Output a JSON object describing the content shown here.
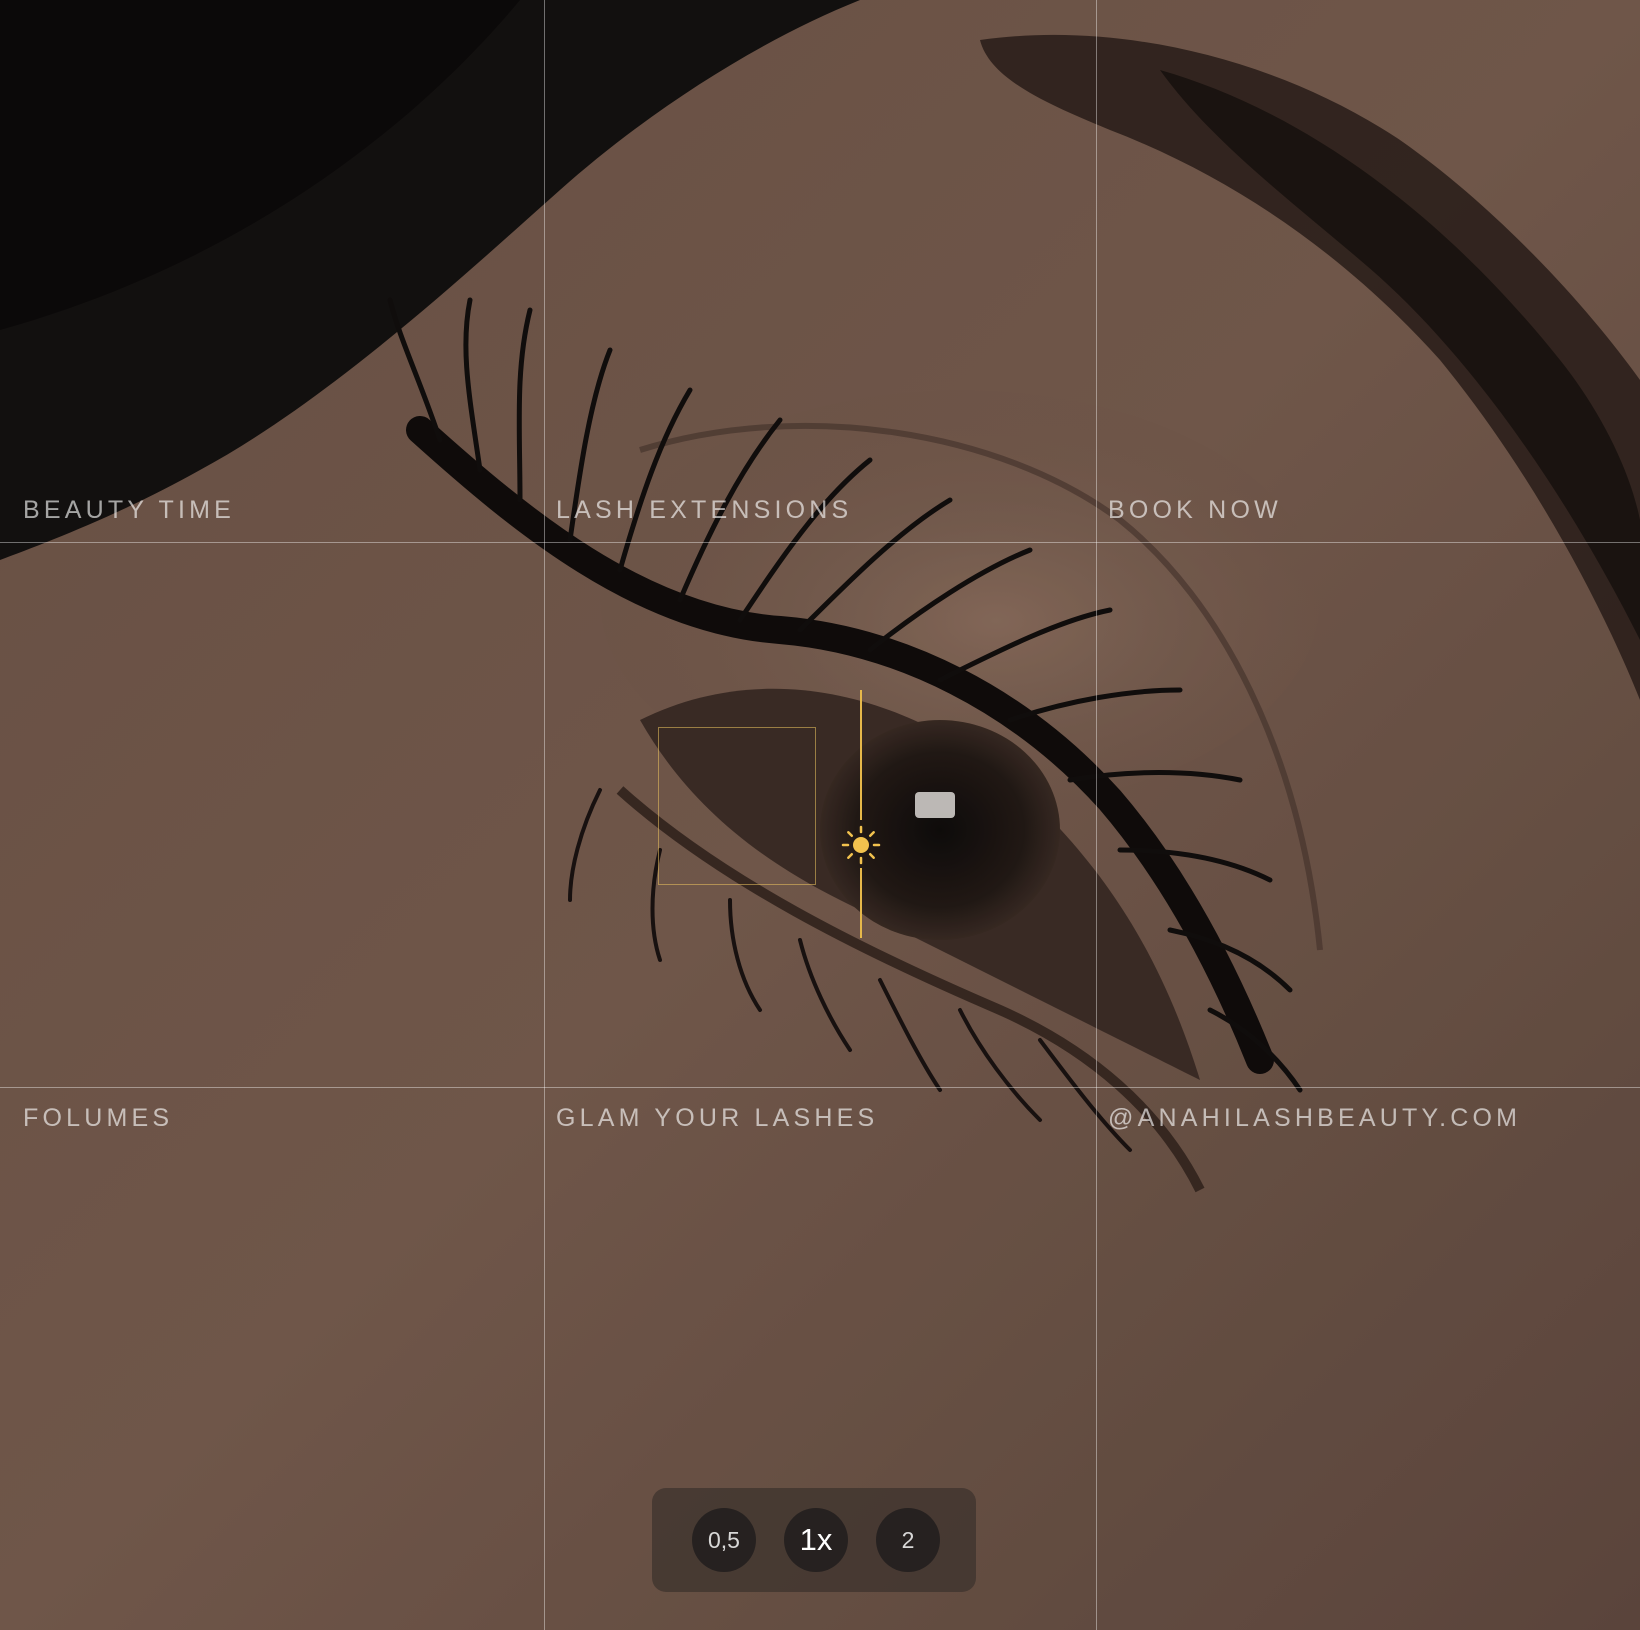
{
  "camera": {
    "grid_labels": {
      "top_left": "BEAUTY TIME",
      "top_center": "LASH EXTENSIONS",
      "top_right": "BOOK NOW",
      "bottom_left": "FOLUMES",
      "bottom_center": "GLAM YOUR LASHES",
      "bottom_right": "@ANAHILASHBEAUTY.COM"
    },
    "exposure_icon": "sun-icon",
    "zoom": {
      "options": [
        "0,5",
        "1x",
        "2"
      ],
      "selected": "1x"
    }
  },
  "colors": {
    "accent": "#e6b84a",
    "skin": "#7a5f51",
    "hair": "#15110f"
  }
}
